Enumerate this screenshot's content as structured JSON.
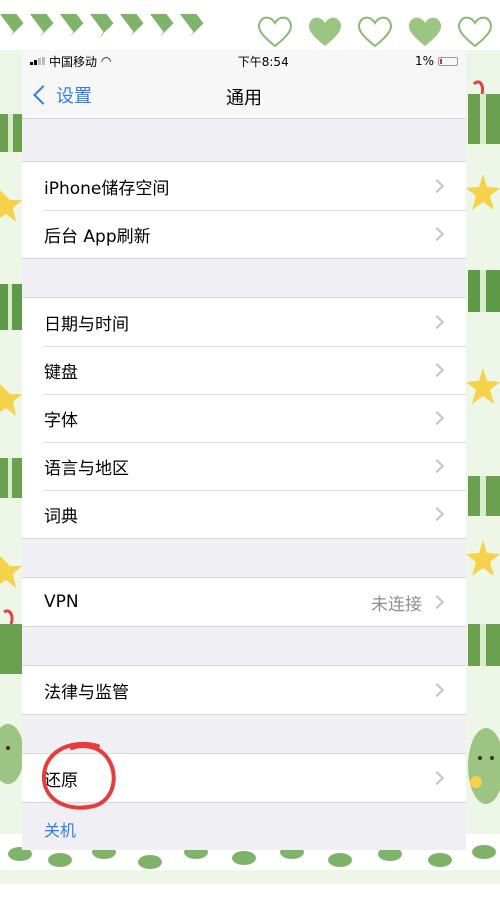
{
  "status_bar": {
    "carrier": "中国移动",
    "time": "下午8:54",
    "battery": "1%"
  },
  "nav": {
    "back_label": "设置",
    "title": "通用"
  },
  "groups": [
    {
      "rows": [
        {
          "label": "iPhone储存空间"
        },
        {
          "label": "后台 App刷新"
        }
      ]
    },
    {
      "rows": [
        {
          "label": "日期与时间"
        },
        {
          "label": "键盘"
        },
        {
          "label": "字体"
        },
        {
          "label": "语言与地区"
        },
        {
          "label": "词典"
        }
      ]
    },
    {
      "rows": [
        {
          "label": "VPN",
          "value": "未连接"
        }
      ]
    },
    {
      "rows": [
        {
          "label": "法律与监管"
        }
      ]
    },
    {
      "rows": [
        {
          "label": "还原"
        }
      ]
    }
  ],
  "shutdown_label": "关机",
  "colors": {
    "accent": "#2f7cf6",
    "annotation": "#e53c3c",
    "frame_green": "#7fb36a"
  }
}
